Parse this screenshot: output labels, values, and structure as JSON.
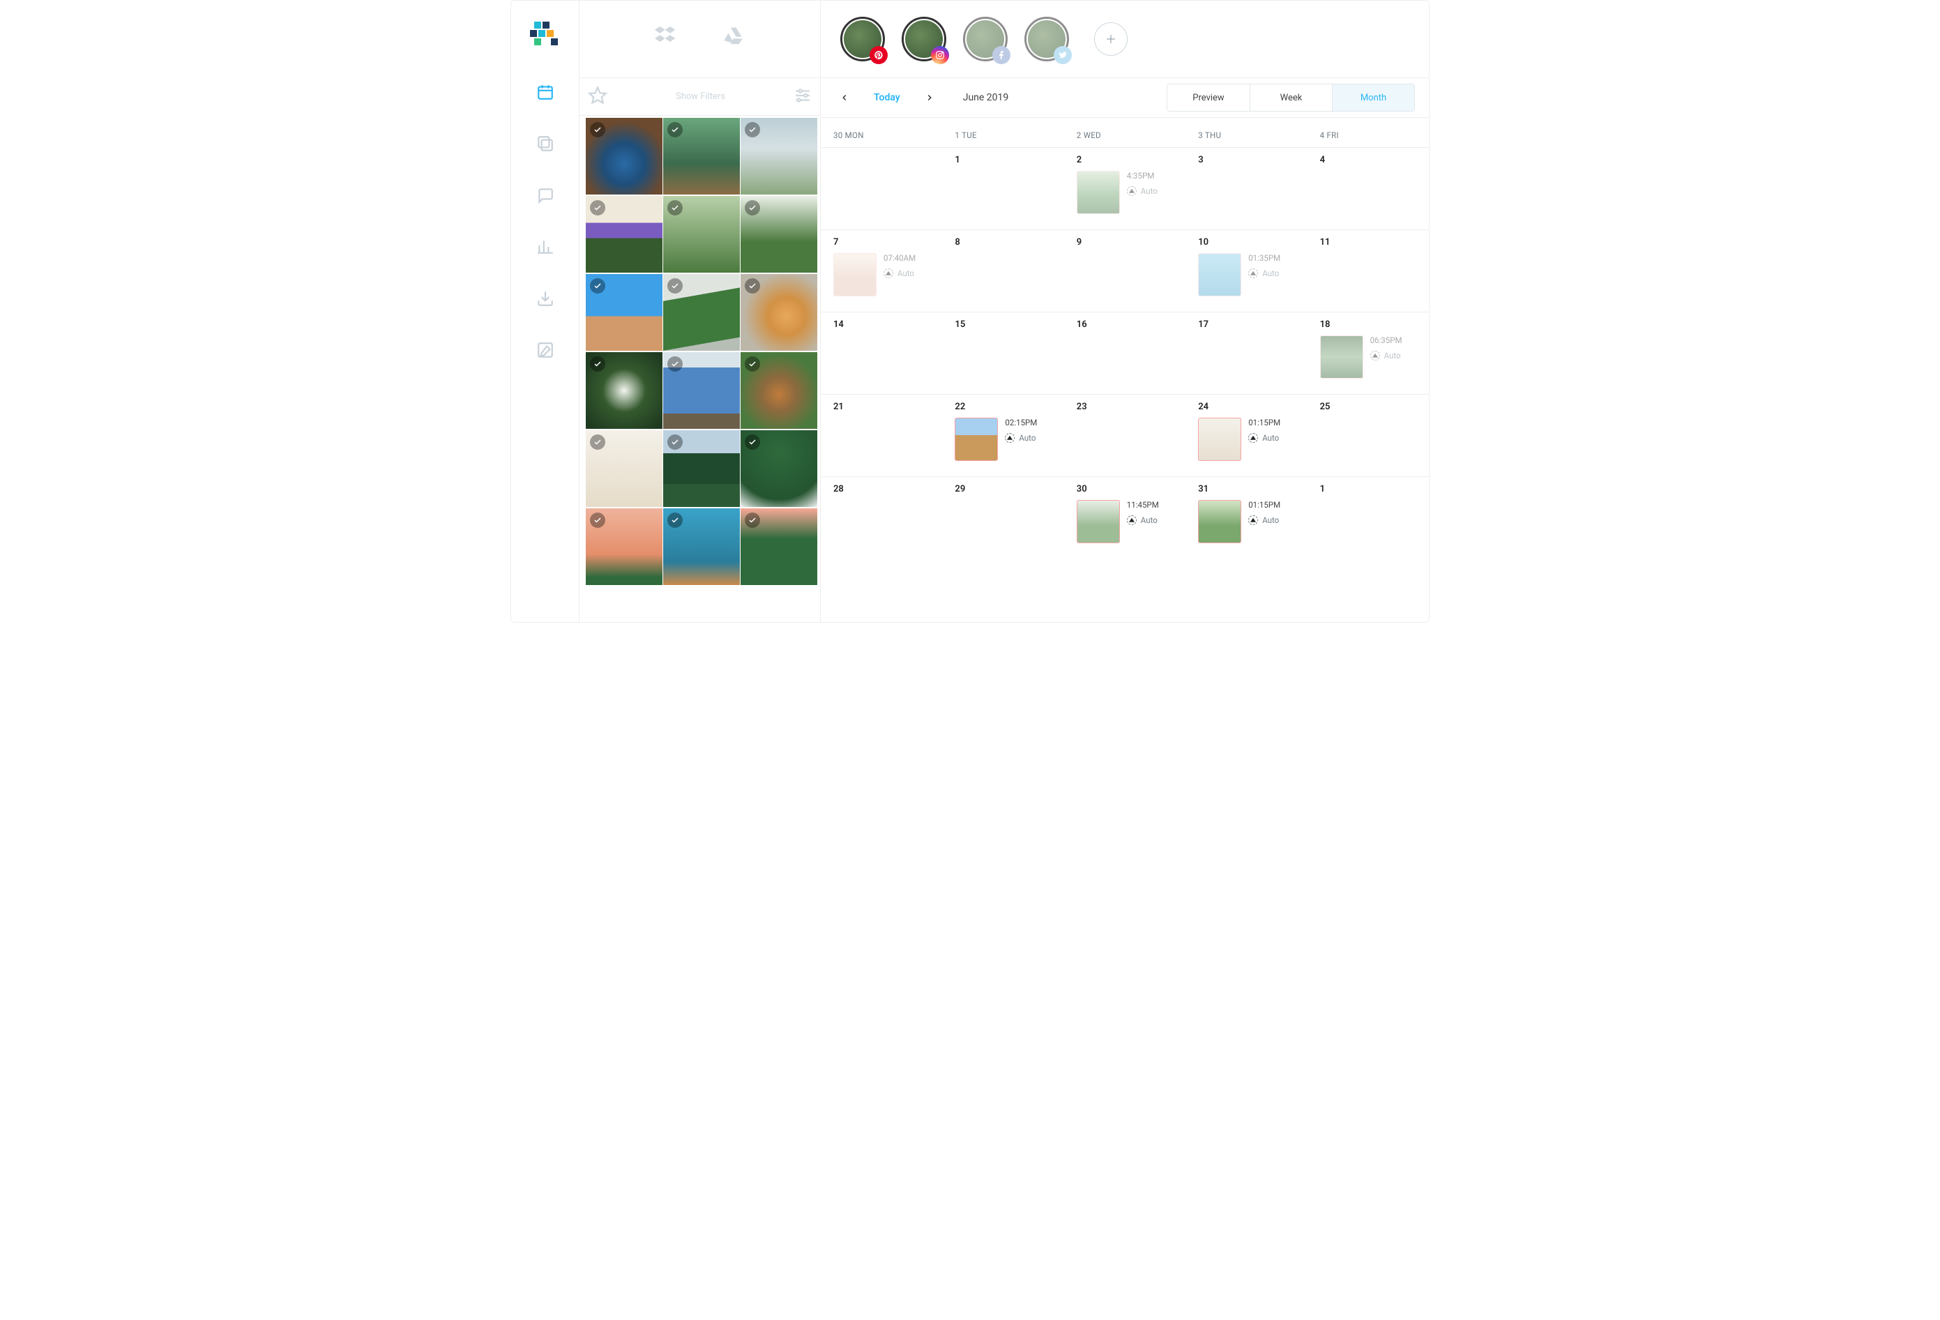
{
  "filters": {
    "show_filters_label": "Show Filters"
  },
  "storage": {
    "dropbox": "dropbox",
    "gdrive": "google-drive"
  },
  "profiles": [
    {
      "network": "pinterest",
      "active": true
    },
    {
      "network": "instagram",
      "active": true
    },
    {
      "network": "facebook",
      "active": false
    },
    {
      "network": "twitter",
      "active": false
    }
  ],
  "datebar": {
    "today_label": "Today",
    "month_label": "June 2019"
  },
  "view_tabs": {
    "preview": "Preview",
    "week": "Week",
    "month": "Month",
    "active": "month"
  },
  "weekdays": [
    "30 MON",
    "1 TUE",
    "2 WED",
    "3 THU",
    "4 FRI"
  ],
  "calendar_rows": [
    [
      {
        "day": ""
      },
      {
        "day": "1"
      },
      {
        "day": "2",
        "post": {
          "time": "4:35PM",
          "auto": "Auto",
          "thumb": "t-greenhouse",
          "muted": true
        }
      },
      {
        "day": "3"
      },
      {
        "day": "4"
      }
    ],
    [
      {
        "day": "7",
        "post": {
          "time": "07:40AM",
          "auto": "Auto",
          "thumb": "t-cactus",
          "muted": true
        }
      },
      {
        "day": "8"
      },
      {
        "day": "9"
      },
      {
        "day": "10",
        "post": {
          "time": "01:35PM",
          "auto": "Auto",
          "thumb": "t-blue",
          "muted": true
        }
      },
      {
        "day": "11"
      }
    ],
    [
      {
        "day": "14"
      },
      {
        "day": "15"
      },
      {
        "day": "16"
      },
      {
        "day": "17"
      },
      {
        "day": "18",
        "post": {
          "time": "06:35PM",
          "auto": "Auto",
          "thumb": "t-forest",
          "muted": true
        }
      }
    ],
    [
      {
        "day": "21"
      },
      {
        "day": "22",
        "post": {
          "time": "02:15PM",
          "auto": "Auto",
          "thumb": "t-field",
          "muted": false
        }
      },
      {
        "day": "23"
      },
      {
        "day": "24",
        "post": {
          "time": "01:15PM",
          "auto": "Auto",
          "thumb": "t-window",
          "muted": false
        }
      },
      {
        "day": "25"
      }
    ],
    [
      {
        "day": "28"
      },
      {
        "day": "29"
      },
      {
        "day": "30",
        "post": {
          "time": "11:45PM",
          "auto": "Auto",
          "thumb": "t-corr",
          "muted": false
        }
      },
      {
        "day": "31",
        "post": {
          "time": "01:15PM",
          "auto": "Auto",
          "thumb": "t-gh2",
          "muted": false
        }
      },
      {
        "day": "1"
      }
    ]
  ],
  "media_grid_rows": [
    [
      "p1",
      "p2",
      "p3"
    ],
    [
      "p4",
      "p5",
      "p6"
    ],
    [
      "p7",
      "p8",
      "p9"
    ],
    [
      "p10",
      "p11",
      "p12"
    ],
    [
      "p13",
      "p14",
      "p15"
    ],
    [
      "p16",
      "p17",
      "p18"
    ]
  ]
}
